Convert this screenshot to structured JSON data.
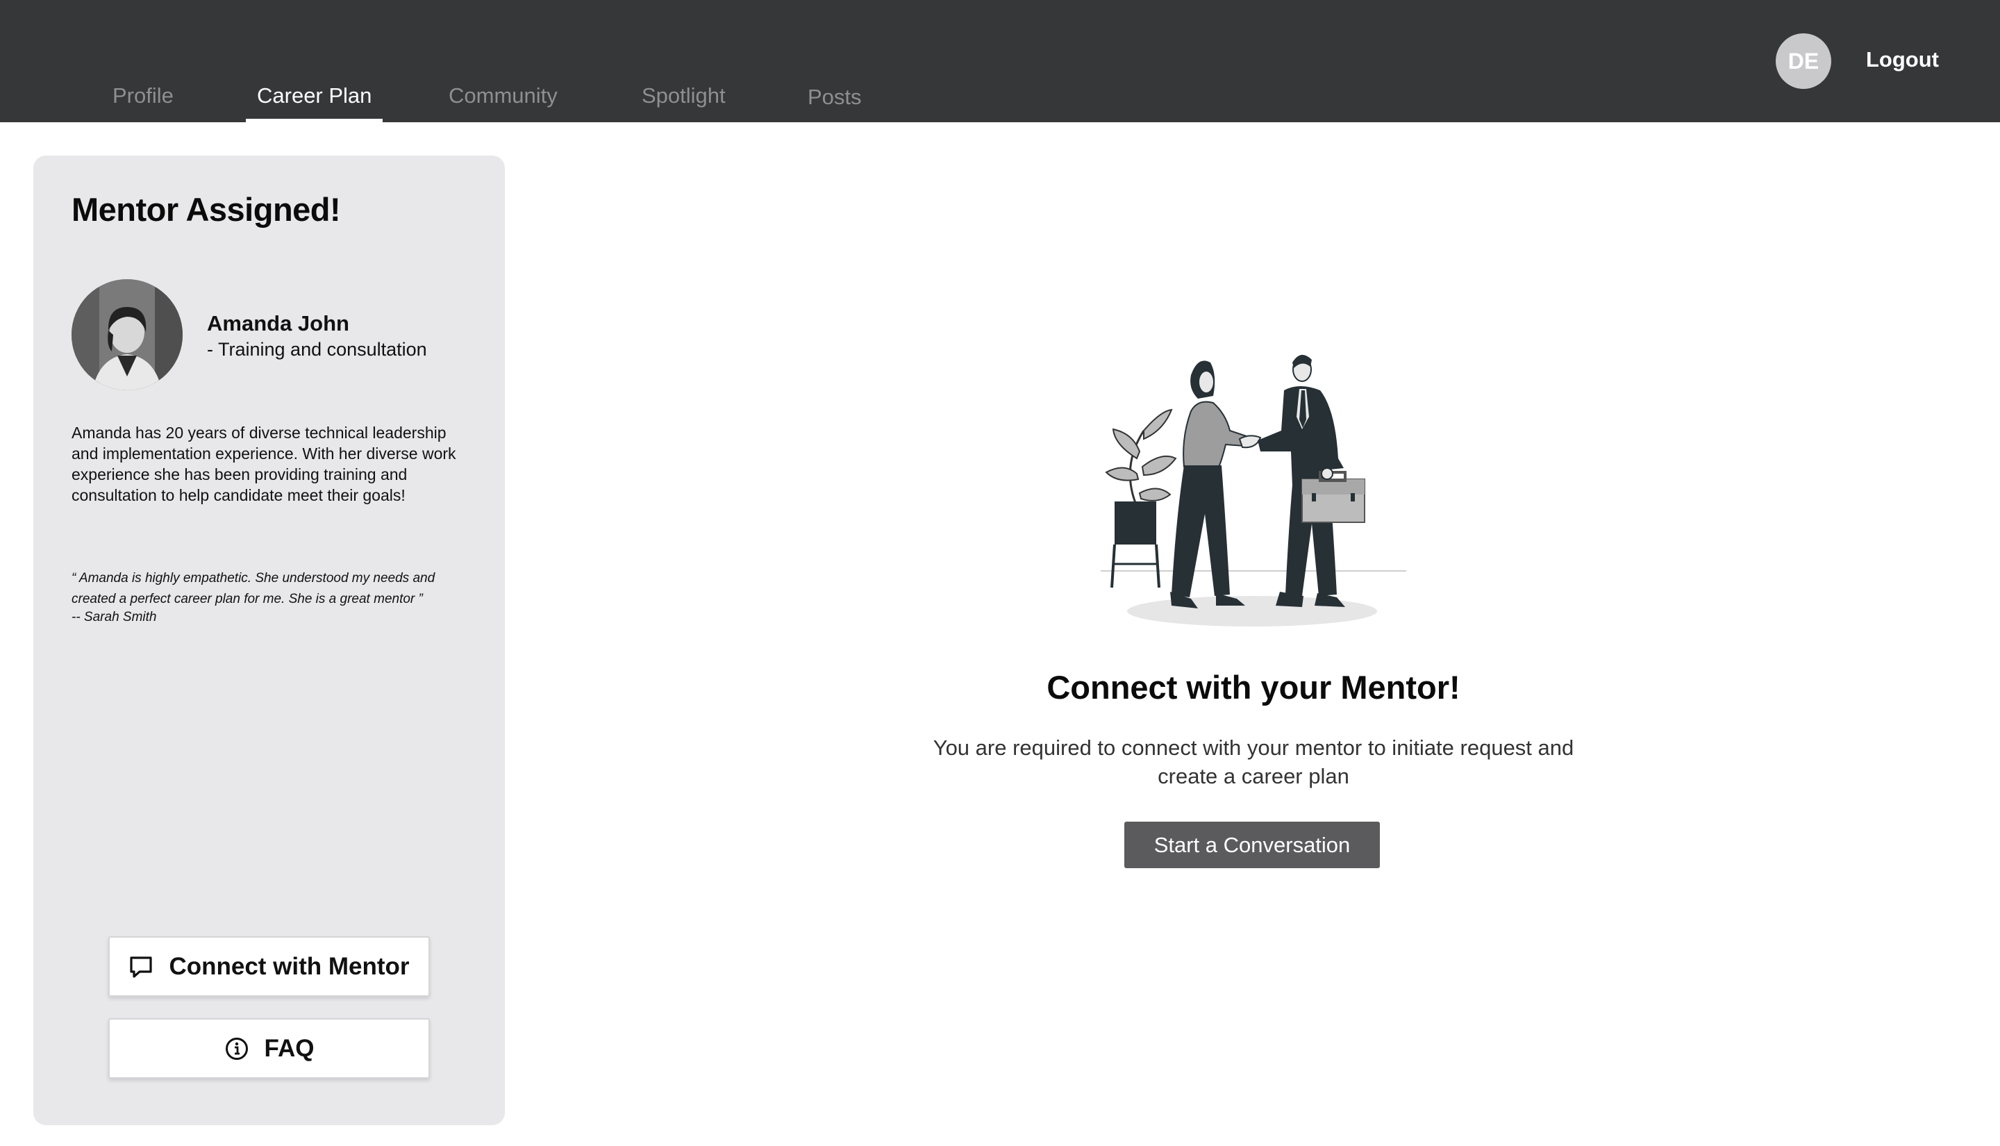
{
  "nav": {
    "tabs": [
      {
        "label": "Profile",
        "active": false
      },
      {
        "label": "Career Plan",
        "active": true
      },
      {
        "label": "Community",
        "active": false
      },
      {
        "label": "Spotlight",
        "active": false
      },
      {
        "label": "Posts",
        "active": false
      }
    ],
    "avatar_initials": "DE",
    "logout_label": "Logout"
  },
  "mentor_card": {
    "title": "Mentor Assigned!",
    "name": "Amanda John",
    "role": "- Training and consultation",
    "bio": "Amanda has 20 years of diverse technical leadership and implementation experience. With her diverse work experience she has been providing training and consultation to help candidate meet their goals!",
    "testimonial": "“ Amanda is highly empathetic. She understood my needs and created a perfect career plan for me. She is a great mentor ”",
    "testimonial_author": "-- Sarah Smith",
    "connect_button": "Connect with Mentor",
    "faq_button": "FAQ"
  },
  "main": {
    "heading": "Connect with your Mentor!",
    "description": "You are required to connect with your mentor to initiate request and create a career plan",
    "cta_label": "Start a Conversation"
  },
  "icons": {
    "chat": "chat-icon",
    "info": "info-icon"
  },
  "colors": {
    "topbar": "#363739",
    "card_bg": "#e8e8ea",
    "cta_bg": "#5b5b5d",
    "tab_inactive": "#8f8f92",
    "tab_active": "#ffffff"
  }
}
